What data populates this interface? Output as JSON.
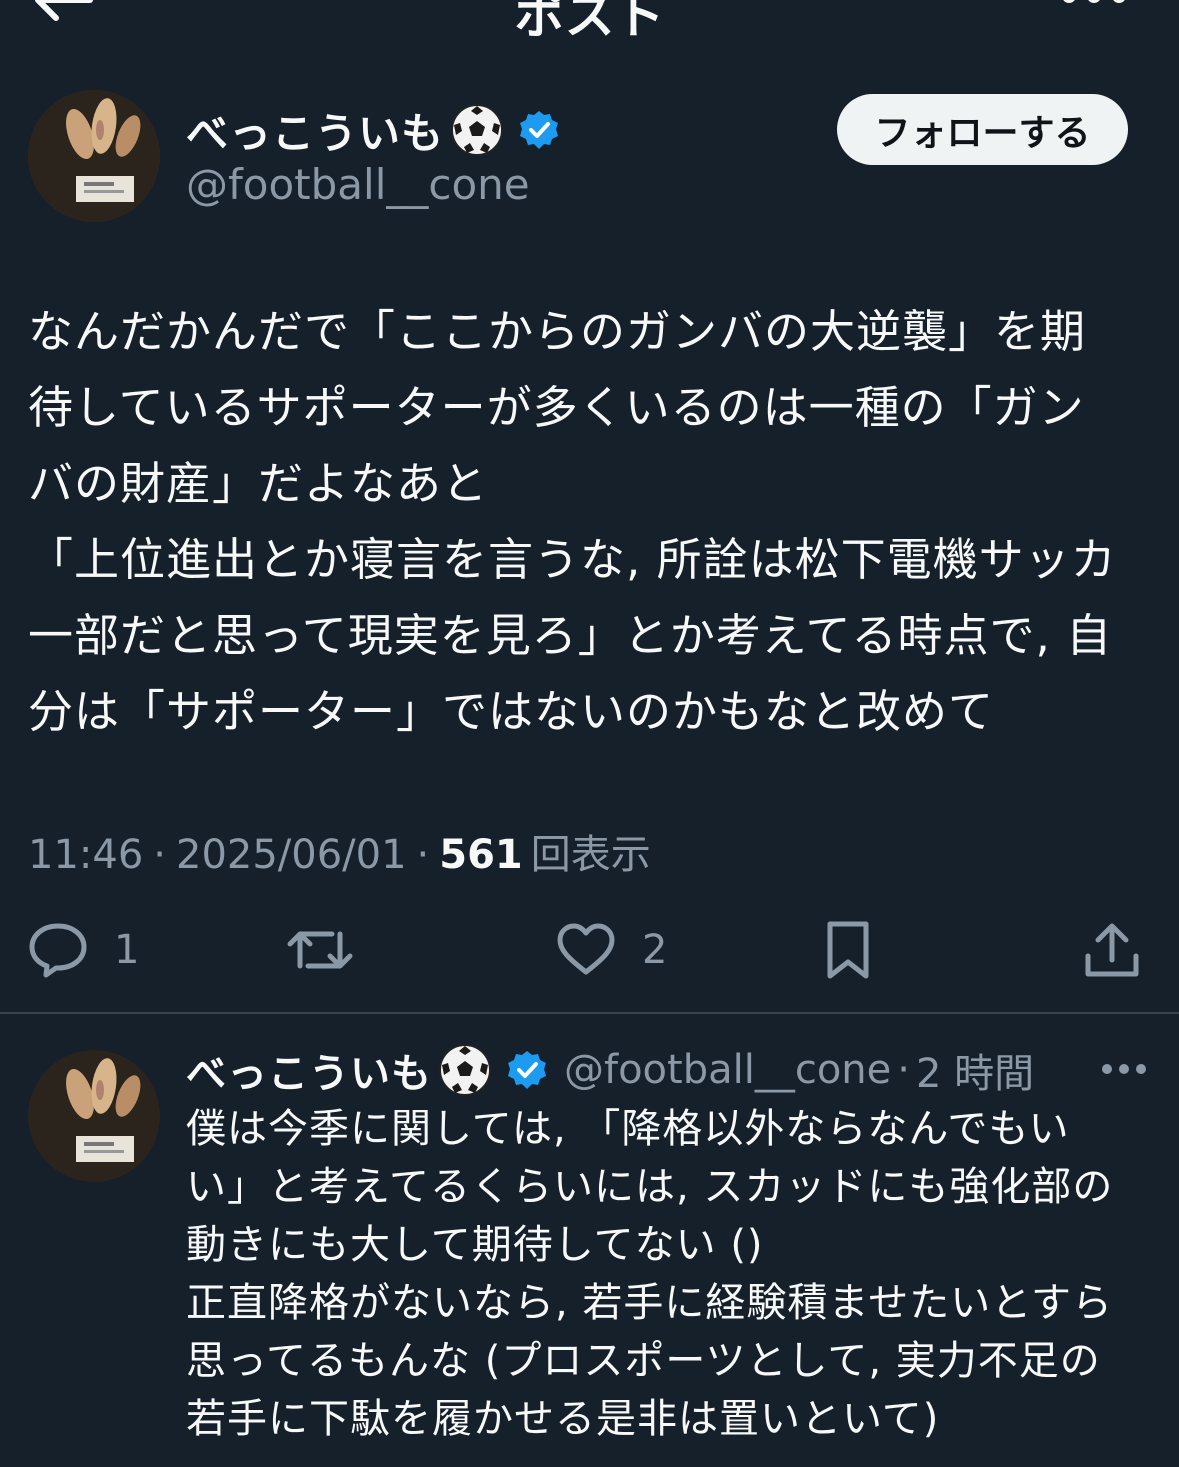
{
  "header": {
    "title": "ポスト",
    "back_icon": "arrow-left-icon",
    "more_icon": "ellipsis-icon"
  },
  "post": {
    "author_name": "べっこういも",
    "author_emoji_icon": "soccer-ball-icon",
    "verified_icon": "verified-badge-icon",
    "handle": "@football__cone",
    "follow_label": "フォローする",
    "text": "なんだかんだで「ここからのガンバの大逆襲」を期\n待しているサポーターが多くいるのは一種の「ガン\nバの財産」だよなあと\n「上位進出とか寝言を言うな, 所詮は松下電機サッカ\n一部だと思って現実を見ろ」とか考えてる時点で, 自\n分は「サポーター」ではないのかもなと改めて",
    "time": "11:46",
    "date": "2025/06/01",
    "separator": "·",
    "views_count": "561",
    "views_label": "回表示",
    "actions": {
      "reply_count": "1",
      "like_count": "2",
      "reply_icon": "comment-icon",
      "retweet_icon": "retweet-icon",
      "like_icon": "heart-icon",
      "bookmark_icon": "bookmark-icon",
      "share_icon": "share-icon"
    }
  },
  "reply": {
    "author_name": "べっこういも",
    "handle": "@football__cone",
    "separator": "·",
    "time_ago": "2 時間",
    "more_icon": "ellipsis-icon",
    "text": "僕は今季に関しては, 「降格以外ならなんでもい\nい」と考えてるくらいには, スカッドにも強化部の\n動きにも大して期待してない ()\n正直降格がないなら, 若手に経験積ませたいとすら\n思ってるもんな (プロスポーツとして, 実力不足の\n若手に下駄を履かせる是非は置いといて)"
  },
  "colors": {
    "background": "#15202b",
    "text_primary": "#f7f9f9",
    "text_secondary": "#8b98a5",
    "verified_blue": "#1d9bf0",
    "follow_button_bg": "#eff3f4",
    "divider": "#38444d"
  }
}
